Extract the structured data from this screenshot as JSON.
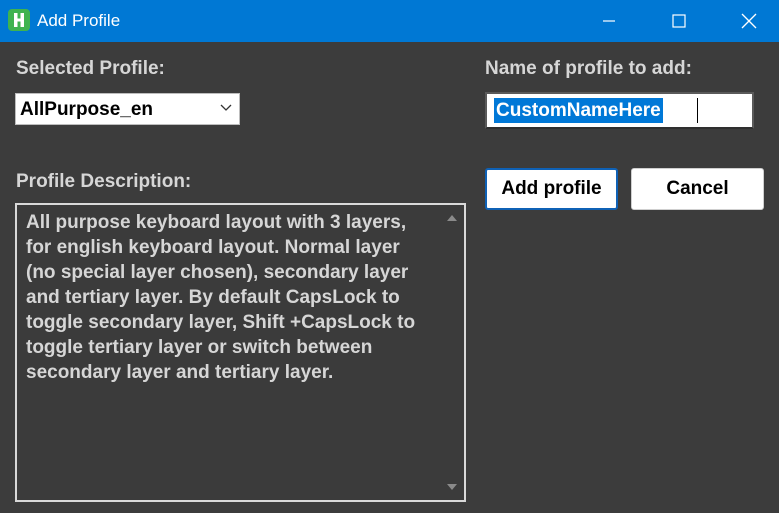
{
  "window": {
    "title": "Add Profile",
    "app_icon_letter": "H",
    "minimize_icon": "minimize-icon",
    "maximize_icon": "maximize-icon",
    "close_icon": "close-icon"
  },
  "left": {
    "selected_profile_label": "Selected Profile:",
    "selected_profile_value": "AllPurpose_en",
    "description_label": "Profile Description:",
    "description_text": "All purpose keyboard layout with 3 layers, for english keyboard layout. Normal layer (no special layer chosen), secondary layer and tertiary layer. By default CapsLock to toggle secondary layer, Shift +CapsLock to toggle tertiary layer or switch between secondary layer and tertiary layer."
  },
  "right": {
    "name_label": "Name of profile to add:",
    "name_value": "CustomNameHere",
    "add_button": "Add profile",
    "cancel_button": "Cancel"
  },
  "colors": {
    "titlebar": "#0078d4",
    "background": "#3c3c3c",
    "selection": "#0078d7",
    "app_icon": "#3fb34f"
  }
}
